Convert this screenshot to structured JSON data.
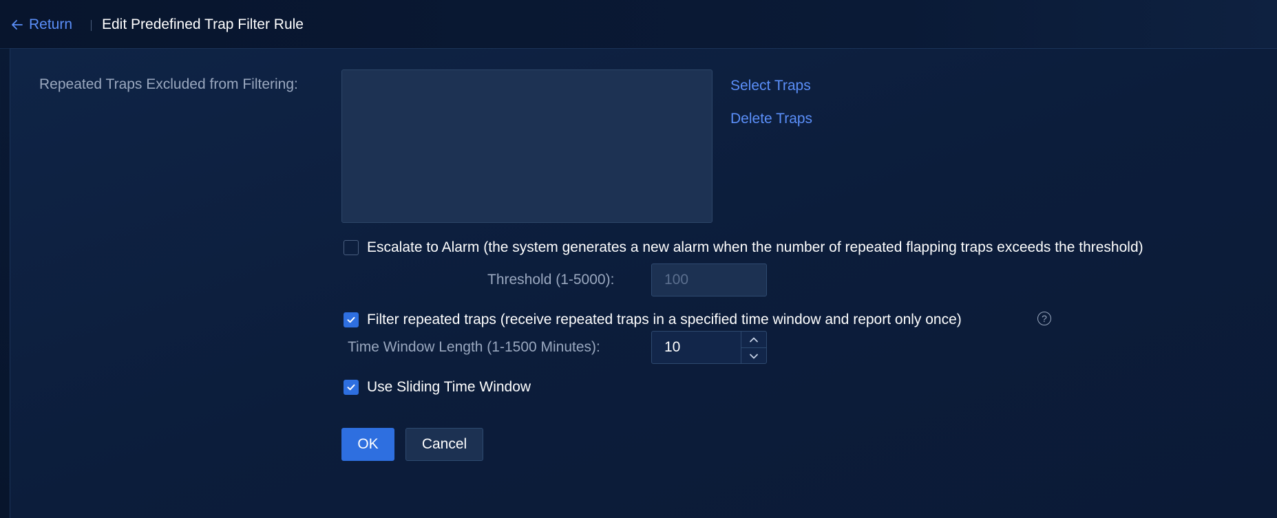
{
  "header": {
    "return_label": "Return",
    "title": "Edit Predefined Trap Filter Rule"
  },
  "form": {
    "excluded_traps_label": "Repeated Traps Excluded from Filtering:",
    "excluded_traps_items": [],
    "select_traps_link": "Select Traps",
    "delete_traps_link": "Delete Traps",
    "escalate": {
      "checked": false,
      "label": "Escalate to Alarm (the system generates a new alarm when the number of repeated flapping traps exceeds the threshold)"
    },
    "threshold": {
      "label": "Threshold (1-5000):",
      "placeholder": "100"
    },
    "filter_repeated": {
      "checked": true,
      "label": "Filter repeated traps (receive repeated traps in a specified time window and report only once)"
    },
    "time_window": {
      "label": "Time Window Length (1-1500 Minutes):",
      "value": "10"
    },
    "sliding_window": {
      "checked": true,
      "label": "Use Sliding Time Window"
    }
  },
  "buttons": {
    "ok": "OK",
    "cancel": "Cancel"
  },
  "colors": {
    "accent": "#2e6fe0",
    "link": "#5b8ff9",
    "background": "#0a1a35"
  },
  "icons": [
    "arrow-left-icon",
    "check-icon",
    "help-icon",
    "chevron-up-icon",
    "chevron-down-icon"
  ]
}
